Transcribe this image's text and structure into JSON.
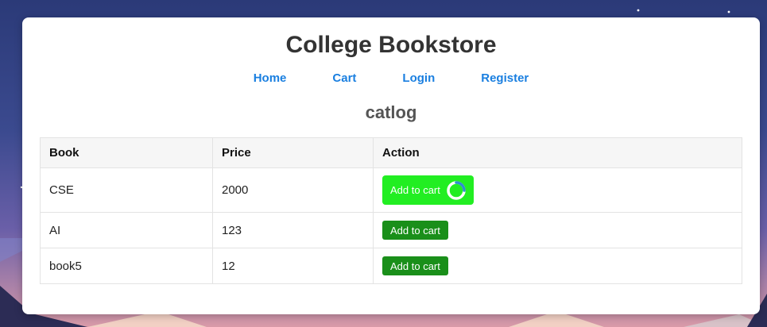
{
  "header": {
    "title": "College Bookstore"
  },
  "nav": {
    "items": [
      {
        "label": "Home"
      },
      {
        "label": "Cart"
      },
      {
        "label": "Login"
      },
      {
        "label": "Register"
      }
    ],
    "link_color": "#1a7fe0"
  },
  "catalog": {
    "heading": "catlog",
    "columns": [
      "Book",
      "Price",
      "Action"
    ],
    "rows": [
      {
        "book": "CSE",
        "price": "2000",
        "action_label": "Add to cart",
        "loading": true
      },
      {
        "book": "AI",
        "price": "123",
        "action_label": "Add to cart",
        "loading": false
      },
      {
        "book": "book5",
        "price": "12",
        "action_label": "Add to cart",
        "loading": false
      }
    ],
    "button_color": "#1a8f1a",
    "button_active_color": "#22ee22"
  }
}
